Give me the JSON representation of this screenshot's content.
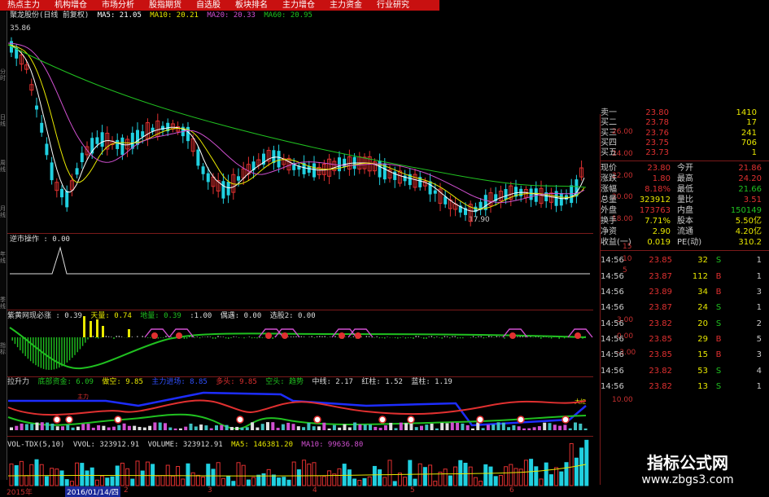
{
  "menu": [
    "热点主力",
    "机构增仓",
    "市场分析",
    "股指期货",
    "自选股",
    "板块排名",
    "主力增仓",
    "主力资金",
    "行业研究"
  ],
  "sidebar": [
    "分时",
    "日线",
    "周线",
    "月线",
    "年线",
    "季线",
    "指标"
  ],
  "main": {
    "label": "聚龙股份(日线 前复权)",
    "ma5": "MA5: 21.05",
    "ma10": "MA10: 20.21",
    "ma20": "MA20: 20.33",
    "ma60": "MA60: 20.95",
    "high": "35.86",
    "low": "17.90",
    "axis": [
      "26.00",
      "24.00",
      "22.00",
      "20.00",
      "18.00"
    ]
  },
  "p2": {
    "label": "逆市操作 : 0.00",
    "axis": [
      "15",
      "10",
      "5"
    ]
  },
  "p3": {
    "label": "紫黄网现必涨 : 0.39",
    "f1": "天量: 0.74",
    "f2": "地量: 0.39",
    "f3": ":1.00",
    "f4": "偶遇: 0.00",
    "f5": "选股2: 0.00",
    "axis": [
      "3.00",
      "0.00",
      "-3.00"
    ]
  },
  "p4": {
    "label": "拉升力",
    "f1": "底部资金: 6.09",
    "f2": "做空: 9.85",
    "f3": "主力进场: 8.85",
    "f4": "多头: 9.85",
    "f5": "空头: 趋势",
    "f6": "中线: 2.17",
    "f7": "红柱: 1.52",
    "f8": "蓝柱: 1.19",
    "axis": [
      "10.00"
    ],
    "tag1": "主力",
    "tag2": "大红"
  },
  "p5": {
    "label": "VOL-TDX(5,10)",
    "f1": "VVOL: 323912.91",
    "f2": "VOLUME: 323912.91",
    "f3": "MA5: 146381.20",
    "f4": "MA10: 99636.80"
  },
  "dates": {
    "year": "2015年",
    "hl": "2016/01/14/四",
    "m2": "2",
    "m3": "3",
    "m4": "4",
    "m5": "5",
    "m6": "6"
  },
  "quote": {
    "asks": [
      {
        "label": "卖一",
        "price": "23.80",
        "vol": "1410"
      },
      {
        "label": "买二",
        "price": "23.78",
        "vol": "17"
      },
      {
        "label": "买三",
        "price": "23.76",
        "vol": "241"
      },
      {
        "label": "买四",
        "price": "23.75",
        "vol": "706"
      },
      {
        "label": "买五",
        "price": "23.73",
        "vol": "1"
      }
    ],
    "stats": [
      {
        "k1": "现价",
        "v1": "23.80",
        "c1": "#e03030",
        "k2": "今开",
        "v2": "21.86",
        "c2": "#e03030"
      },
      {
        "k1": "涨跌",
        "v1": "1.80",
        "c1": "#e03030",
        "k2": "最高",
        "v2": "24.20",
        "c2": "#e03030"
      },
      {
        "k1": "涨幅",
        "v1": "8.18%",
        "c1": "#e03030",
        "k2": "最低",
        "v2": "21.66",
        "c2": "#20c020"
      },
      {
        "k1": "总量",
        "v1": "323912",
        "c1": "#e8e800",
        "k2": "量比",
        "v2": "3.51",
        "c2": "#e03030"
      },
      {
        "k1": "外盘",
        "v1": "173763",
        "c1": "#e03030",
        "k2": "内盘",
        "v2": "150149",
        "c2": "#20c020"
      },
      {
        "k1": "换手",
        "v1": "7.71%",
        "c1": "#e8e800",
        "k2": "股本",
        "v2": "5.50亿",
        "c2": "#e8e800"
      },
      {
        "k1": "净资",
        "v1": "2.90",
        "c1": "#e8e800",
        "k2": "流通",
        "v2": "4.20亿",
        "c2": "#e8e800"
      },
      {
        "k1": "收益(一)",
        "v1": "0.019",
        "c1": "#e8e800",
        "k2": "PE(动)",
        "v2": "310.2",
        "c2": "#e8e800"
      }
    ],
    "ticks": [
      {
        "t": "14:56",
        "p": "23.85",
        "v": "32",
        "d": "S",
        "n": "1"
      },
      {
        "t": "14:56",
        "p": "23.87",
        "v": "112",
        "d": "B",
        "n": "1"
      },
      {
        "t": "14:56",
        "p": "23.89",
        "v": "34",
        "d": "B",
        "n": "3"
      },
      {
        "t": "14:56",
        "p": "23.87",
        "v": "24",
        "d": "S",
        "n": "1"
      },
      {
        "t": "14:56",
        "p": "23.82",
        "v": "20",
        "d": "S",
        "n": "2"
      },
      {
        "t": "14:56",
        "p": "23.85",
        "v": "29",
        "d": "B",
        "n": "5"
      },
      {
        "t": "14:56",
        "p": "23.85",
        "v": "15",
        "d": "B",
        "n": "3"
      },
      {
        "t": "14:56",
        "p": "23.82",
        "v": "53",
        "d": "S",
        "n": "4"
      },
      {
        "t": "14:56",
        "p": "23.82",
        "v": "13",
        "d": "S",
        "n": "1"
      }
    ]
  },
  "watermark": {
    "title": "指标公式网",
    "url": "www.zbgs3.com"
  },
  "colors": {
    "up": "#e03030",
    "down": "#20d0e0",
    "ma5": "#ffffff",
    "ma10": "#e8e800",
    "ma20": "#d050d0",
    "ma60": "#20c020"
  }
}
